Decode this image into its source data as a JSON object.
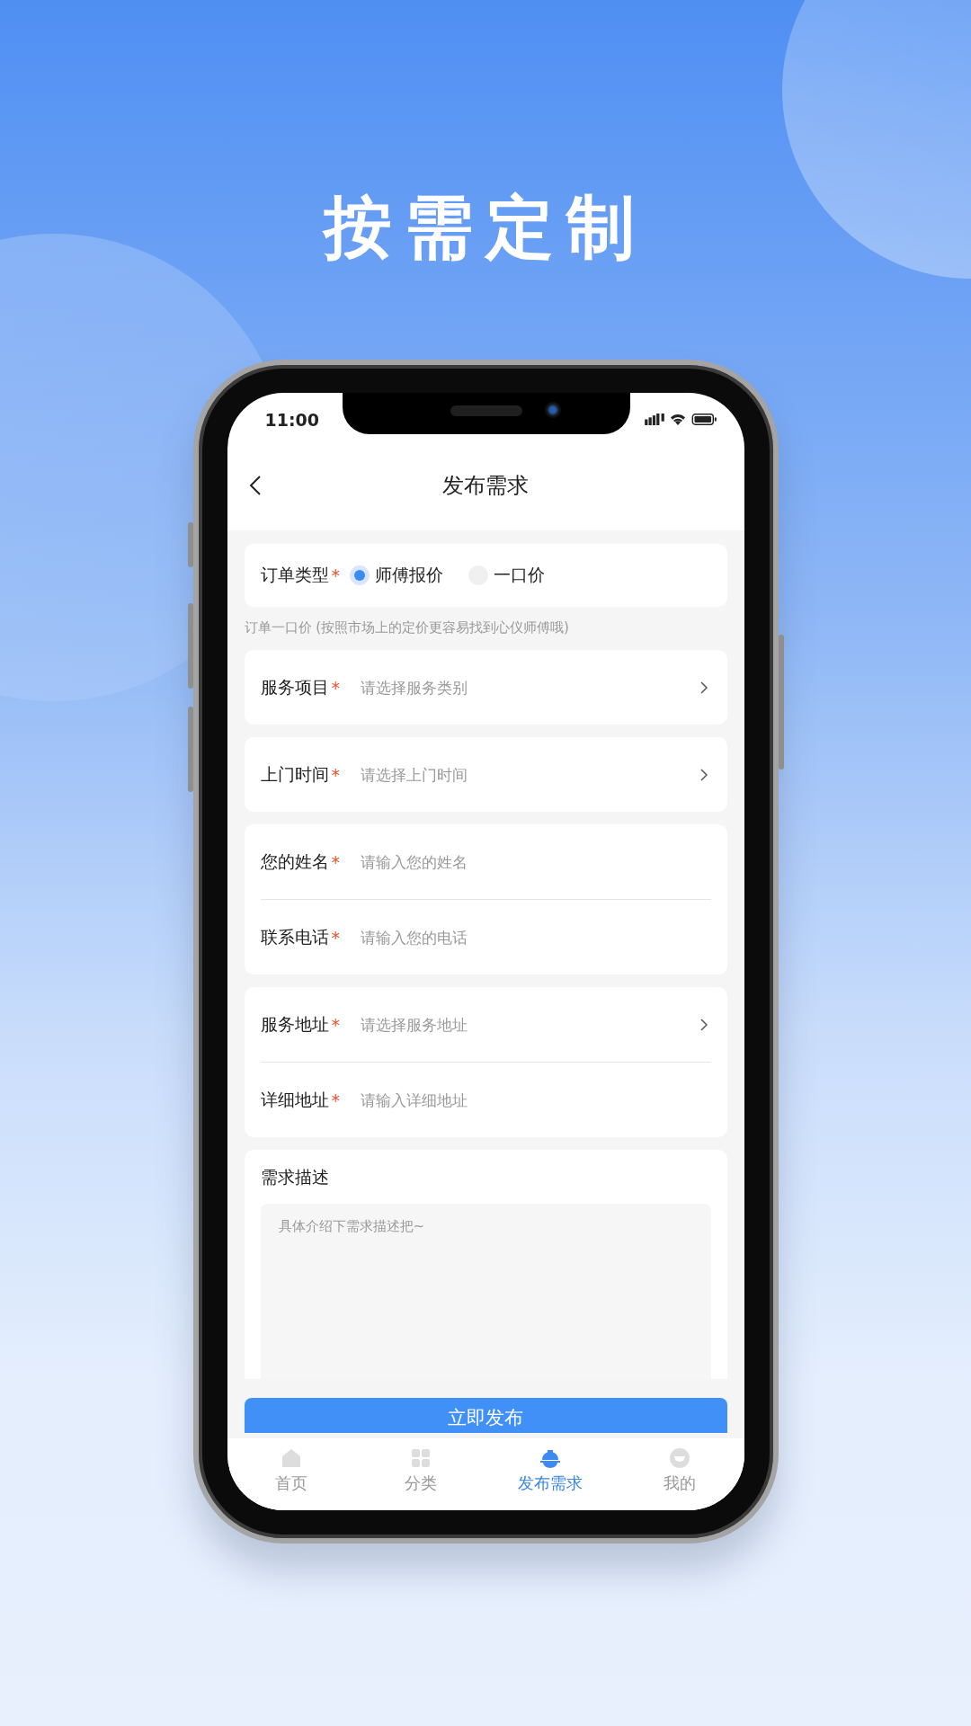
{
  "headline": "按需定制",
  "status_bar": {
    "time": "11:00"
  },
  "nav": {
    "title": "发布需求"
  },
  "order_type": {
    "label": "订单类型",
    "required_mark": "*",
    "options": [
      {
        "label": "师傅报价",
        "selected": true
      },
      {
        "label": "一口价",
        "selected": false
      }
    ]
  },
  "hint": "订单一口价 (按照市场上的定价更容易找到心仪师傅哦)",
  "groups": [
    {
      "fields": [
        {
          "label": "服务项目",
          "required_mark": "*",
          "placeholder": "请选择服务类别",
          "kind": "select"
        }
      ]
    },
    {
      "fields": [
        {
          "label": "上门时间",
          "required_mark": "*",
          "placeholder": "请选择上门时间",
          "kind": "select"
        }
      ]
    },
    {
      "fields": [
        {
          "label": "您的姓名",
          "required_mark": "*",
          "placeholder": "请输入您的姓名",
          "kind": "input"
        },
        {
          "label": "联系电话",
          "required_mark": "*",
          "placeholder": "请输入您的电话",
          "kind": "input"
        }
      ]
    },
    {
      "fields": [
        {
          "label": "服务地址",
          "required_mark": "*",
          "placeholder": "请选择服务地址",
          "kind": "select"
        },
        {
          "label": "详细地址",
          "required_mark": "*",
          "placeholder": "请输入详细地址",
          "kind": "input"
        }
      ]
    }
  ],
  "description": {
    "label": "需求描述",
    "placeholder": "具体介绍下需求描述把~"
  },
  "submit": "立即发布",
  "tabs": [
    {
      "label": "首页",
      "kind": "home",
      "selected": false
    },
    {
      "label": "分类",
      "kind": "grid",
      "selected": false
    },
    {
      "label": "发布需求",
      "kind": "helmet",
      "selected": true
    },
    {
      "label": "我的",
      "kind": "face",
      "selected": false
    }
  ]
}
